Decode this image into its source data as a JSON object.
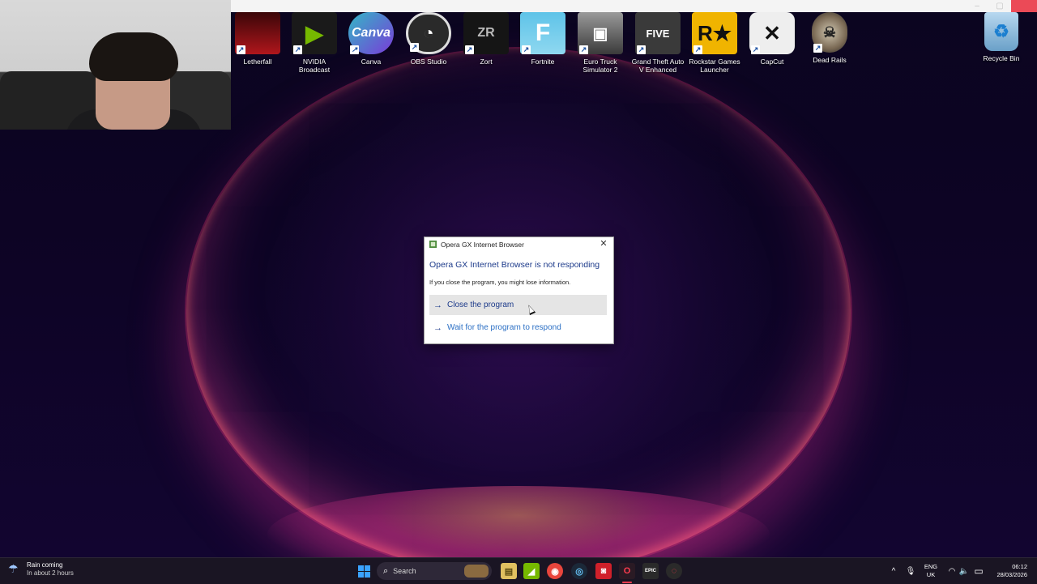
{
  "desktop_icons": [
    {
      "label": "Letherfall",
      "icon": "letherfall-icon",
      "color": "#b0161c"
    },
    {
      "label": "NVIDIA Broadcast",
      "icon": "nvidia-broadcast-icon",
      "color": "#1a1a1a"
    },
    {
      "label": "Canva",
      "icon": "canva-icon",
      "color": "#33b8c6"
    },
    {
      "label": "OBS Studio",
      "icon": "obs-icon",
      "color": "#2a2a2a"
    },
    {
      "label": "Zort",
      "icon": "zort-icon",
      "color": "#1a1a1a"
    },
    {
      "label": "Fortnite",
      "icon": "fortnite-icon",
      "color": "#5ec3e8"
    },
    {
      "label": "Euro Truck Simulator 2",
      "icon": "euro-truck-icon",
      "color": "#6b6b6b"
    },
    {
      "label": "Grand Theft Auto V Enhanced",
      "icon": "gta-v-icon",
      "color": "#3a3a3a"
    },
    {
      "label": "Rockstar Games Launcher",
      "icon": "rockstar-icon",
      "color": "#f0b400"
    },
    {
      "label": "CapCut",
      "icon": "capcut-icon",
      "color": "#eeeeee"
    },
    {
      "label": "Dead Rails",
      "icon": "dead-rails-icon",
      "color": "#7b6a55"
    },
    {
      "label": "Recycle Bin",
      "icon": "recycle-bin-icon",
      "color": "#8ab6d8"
    }
  ],
  "dialog": {
    "title": "Opera GX Internet Browser",
    "heading": "Opera GX Internet Browser is not responding",
    "message": "If you close the program, you might lose information.",
    "close_option": "Close the program",
    "wait_option": "Wait for the program to respond",
    "close_glyph": "✕",
    "arrow_glyph": "→"
  },
  "taskbar": {
    "weather_title": "Rain coming",
    "weather_sub": "In about 2 hours",
    "search_label": "Search",
    "apps": [
      {
        "name": "file-explorer-app",
        "glyph": "▤",
        "color": "#e0c060"
      },
      {
        "name": "nvidia-app",
        "glyph": "◢",
        "color": "#76b900"
      },
      {
        "name": "chrome-app",
        "glyph": "◉",
        "color": "#e8453c"
      },
      {
        "name": "steam-app",
        "glyph": "◎",
        "color": "#1b2838"
      },
      {
        "name": "recorder-app",
        "glyph": "◙",
        "color": "#d0202a"
      },
      {
        "name": "opera-gx-app",
        "glyph": "O",
        "color": "#2a1a24"
      },
      {
        "name": "epic-games-app",
        "glyph": "EPIC",
        "color": "#2a2a2a"
      },
      {
        "name": "opera-app",
        "glyph": "◌",
        "color": "#2a2a2a"
      }
    ],
    "lang": "ENG",
    "region": "UK",
    "time": "06:12",
    "date": "28/03/2026",
    "chevron_glyph": "^",
    "mic_glyph": "🎙",
    "wifi_glyph": "◠",
    "volume_glyph": "🔈",
    "battery_glyph": "▭"
  }
}
